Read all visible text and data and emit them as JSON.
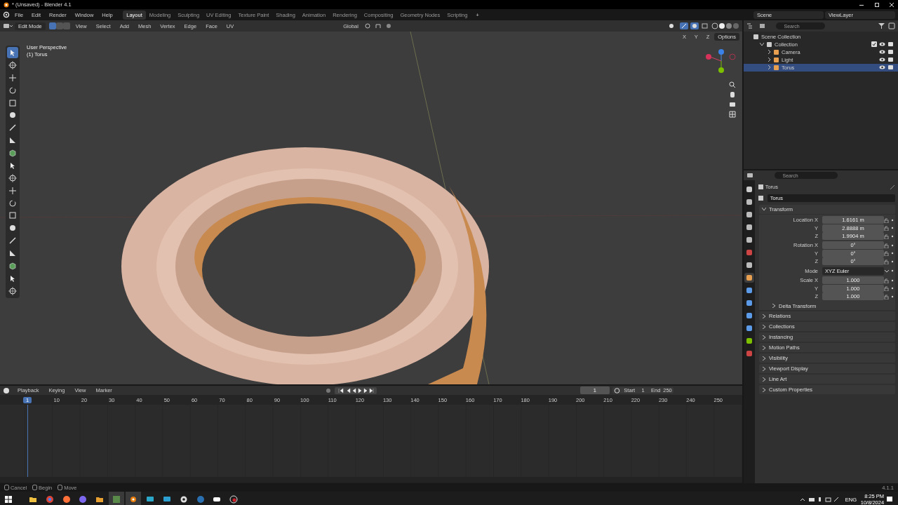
{
  "window": {
    "title": "* (Unsaved) - Blender 4.1"
  },
  "menu": [
    "File",
    "Edit",
    "Render",
    "Window",
    "Help"
  ],
  "workspaces": [
    {
      "label": "Layout",
      "selected": true
    },
    {
      "label": "Modeling",
      "selected": false
    },
    {
      "label": "Sculpting",
      "selected": false
    },
    {
      "label": "UV Editing",
      "selected": false
    },
    {
      "label": "Texture Paint",
      "selected": false
    },
    {
      "label": "Shading",
      "selected": false
    },
    {
      "label": "Animation",
      "selected": false
    },
    {
      "label": "Rendering",
      "selected": false
    },
    {
      "label": "Compositing",
      "selected": false
    },
    {
      "label": "Geometry Nodes",
      "selected": false
    },
    {
      "label": "Scripting",
      "selected": false
    }
  ],
  "add_workspace": "+",
  "scene": "Scene",
  "view_layer": "ViewLayer",
  "viewport_header": {
    "mode": "Edit Mode",
    "select_modes": [
      {
        "selected": true
      },
      {
        "selected": false
      },
      {
        "selected": false
      }
    ],
    "menus": [
      "View",
      "Select",
      "Add",
      "Mesh",
      "Vertex",
      "Edge",
      "Face",
      "UV"
    ],
    "orientation": "Global",
    "axes": [
      "X",
      "Y",
      "Z"
    ],
    "options": "Options"
  },
  "viewport": {
    "perspective": "User Perspective",
    "object": "(1) Torus",
    "tools": [
      {
        "selected": true
      },
      {
        "selected": false
      },
      {
        "selected": false
      },
      {
        "selected": false
      },
      {
        "selected": false
      },
      {
        "selected": false
      },
      {
        "selected": false
      },
      {
        "selected": false
      },
      {
        "selected": false
      },
      {
        "selected": false
      },
      {
        "selected": false
      },
      {
        "selected": false
      },
      {
        "selected": false
      },
      {
        "selected": false
      },
      {
        "selected": false
      },
      {
        "selected": false
      },
      {
        "selected": false
      },
      {
        "selected": false
      },
      {
        "selected": false
      },
      {
        "selected": false
      }
    ]
  },
  "outliner": {
    "placeholder": "Search",
    "items": [
      {
        "label": "Scene Collection",
        "selected": false,
        "children": [
          {
            "label": "Collection",
            "selected": false,
            "children": [
              {
                "label": "Camera",
                "selected": false
              },
              {
                "label": "Light",
                "selected": false
              },
              {
                "label": "Torus",
                "selected": true
              }
            ]
          }
        ]
      }
    ]
  },
  "properties": {
    "placeholder": "Search",
    "object_name": "Torus",
    "data_name": "Torus",
    "tabs": [
      {
        "selected": false
      },
      {
        "selected": false
      },
      {
        "selected": false
      },
      {
        "selected": false
      },
      {
        "selected": false
      },
      {
        "selected": false
      },
      {
        "selected": false
      },
      {
        "selected": true
      },
      {
        "selected": false
      },
      {
        "selected": false
      },
      {
        "selected": false
      },
      {
        "selected": false
      },
      {
        "selected": false
      },
      {
        "selected": false
      }
    ],
    "transform": {
      "title": "Transform",
      "expanded": true,
      "groups": [
        [
          {
            "label": "Location X",
            "value": "1.6161 m",
            "kind": "number"
          },
          {
            "label": "Y",
            "value": "2.8888 m",
            "kind": "number"
          },
          {
            "label": "Z",
            "value": "1.9904 m",
            "kind": "number"
          }
        ],
        [
          {
            "label": "Rotation X",
            "value": "0°",
            "kind": "number"
          },
          {
            "label": "Y",
            "value": "0°",
            "kind": "number"
          },
          {
            "label": "Z",
            "value": "0°",
            "kind": "number"
          }
        ],
        [
          {
            "label": "Mode",
            "value": "XYZ Euler",
            "kind": "dropdown"
          }
        ],
        [
          {
            "label": "Scale X",
            "value": "1.000",
            "kind": "number"
          },
          {
            "label": "Y",
            "value": "1.000",
            "kind": "number"
          },
          {
            "label": "Z",
            "value": "1.000",
            "kind": "number"
          }
        ]
      ]
    },
    "panels": [
      {
        "label": "Delta Transform",
        "kind": "subpanel",
        "expanded": false
      },
      {
        "label": "Relations",
        "kind": "panel",
        "expanded": false
      },
      {
        "label": "Collections",
        "kind": "panel",
        "expanded": false
      },
      {
        "label": "Instancing",
        "kind": "panel",
        "expanded": false
      },
      {
        "label": "Motion Paths",
        "kind": "panel",
        "expanded": false
      },
      {
        "label": "Visibility",
        "kind": "panel",
        "expanded": false
      },
      {
        "label": "Viewport Display",
        "kind": "panel",
        "expanded": false
      },
      {
        "label": "Line Art",
        "kind": "panel",
        "expanded": false
      },
      {
        "label": "Custom Properties",
        "kind": "panel",
        "expanded": false
      }
    ]
  },
  "timeline": {
    "menus": [
      "Playback",
      "Keying",
      "View",
      "Marker"
    ],
    "current_frame": "1",
    "start_label": "Start",
    "start": "1",
    "end_label": "End",
    "end": "250",
    "playhead": "1",
    "ticks": [
      "10",
      "20",
      "30",
      "40",
      "50",
      "60",
      "70",
      "80",
      "90",
      "100",
      "110",
      "120",
      "130",
      "140",
      "150",
      "160",
      "170",
      "180",
      "190",
      "200",
      "210",
      "220",
      "230",
      "240",
      "250"
    ]
  },
  "status_bar": {
    "hints": [
      "Cancel",
      "Begin",
      "Move"
    ],
    "version": "4.1.1"
  },
  "taskbar": {
    "apps": [
      {
        "selected": false
      },
      {
        "selected": false
      },
      {
        "selected": false
      },
      {
        "selected": false
      },
      {
        "selected": false
      },
      {
        "selected": true
      },
      {
        "selected": true
      },
      {
        "selected": false
      },
      {
        "selected": false
      },
      {
        "selected": false
      },
      {
        "selected": false
      },
      {
        "selected": false
      },
      {
        "selected": false
      }
    ],
    "language": "ENG",
    "time": "8:25 PM",
    "date": "10/8/2024"
  }
}
